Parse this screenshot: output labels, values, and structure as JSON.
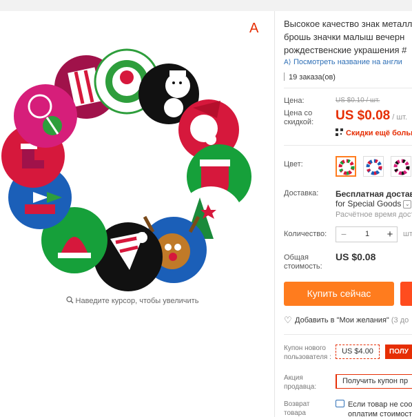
{
  "gallery": {
    "badge": "A",
    "zoom_hint": "Наведите курсор, чтобы увеличить"
  },
  "product": {
    "title_lines": [
      "Высокое качество знак металл",
      "брошь значки малыш вечерн",
      "рождественские украшения #"
    ],
    "translate_link": "Посмотреть название на англи",
    "orders": "19 заказа(ов)"
  },
  "price": {
    "label": "Цена:",
    "old": "US $0.10 / шт.",
    "discount_label": "Цена со скидкой:",
    "new_amount": "US $0.08",
    "new_unit": "/ шт.",
    "more_discounts": "Скидки ещё больш"
  },
  "color": {
    "label": "Цвет:",
    "swatches": [
      "variant-1",
      "variant-2",
      "variant-3"
    ],
    "selected_index": 0
  },
  "shipping": {
    "label": "Доставка:",
    "method": "Бесплатная доставка",
    "carrier": "for Special Goods",
    "eta": "Расчётное время дост"
  },
  "quantity": {
    "label": "Количество:",
    "value": "1",
    "minus": "−",
    "plus": "+",
    "unit": "шт"
  },
  "total": {
    "label": "Общая стоимость:",
    "value": "US $0.08"
  },
  "actions": {
    "buy_now": "Купить сейчас"
  },
  "wishlist": {
    "text": "Добавить в \"Мои желания\"",
    "count": "(3 до"
  },
  "coupon": {
    "label": "Купон нового пользователя :",
    "value": "US $4.00",
    "get": "ПОЛУ"
  },
  "promo": {
    "label": "Акция продавца:",
    "text": "Получить купон пр"
  },
  "returns": {
    "label": "Возврат товара",
    "line1": "Если товар не соо",
    "line2": "оплатим стоимост"
  },
  "colors": {
    "accent": "#ff7c1e",
    "price_red": "#e62e04",
    "link_blue": "#2e6fb6"
  }
}
